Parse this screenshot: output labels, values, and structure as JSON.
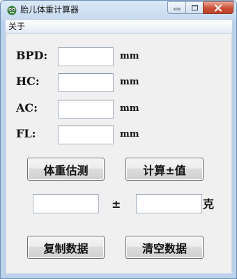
{
  "window": {
    "title": "胎儿体重计算器",
    "icon": "app-icon"
  },
  "caption_buttons": {
    "minimize_icon": "minimize-icon",
    "maximize_icon": "maximize-icon",
    "close_icon": "close-icon"
  },
  "menu": {
    "items": [
      {
        "label": "关于"
      }
    ]
  },
  "fields": [
    {
      "label": "BPD:",
      "value": "",
      "unit": "mm"
    },
    {
      "label": "HC:",
      "value": "",
      "unit": "mm"
    },
    {
      "label": "AC:",
      "value": "",
      "unit": "mm"
    },
    {
      "label": "FL:",
      "value": "",
      "unit": "mm"
    }
  ],
  "buttons": {
    "estimate": "体重估测",
    "calculate_range": "计算±值",
    "copy_data": "复制数据",
    "clear_data": "清空数据"
  },
  "result": {
    "weight_value": "",
    "pm_sign": "±",
    "range_value": "",
    "unit": "克"
  },
  "colors": {
    "window_frame": "#c7daee",
    "close_button": "#c94f35",
    "client_background": "#f0f0f0"
  }
}
